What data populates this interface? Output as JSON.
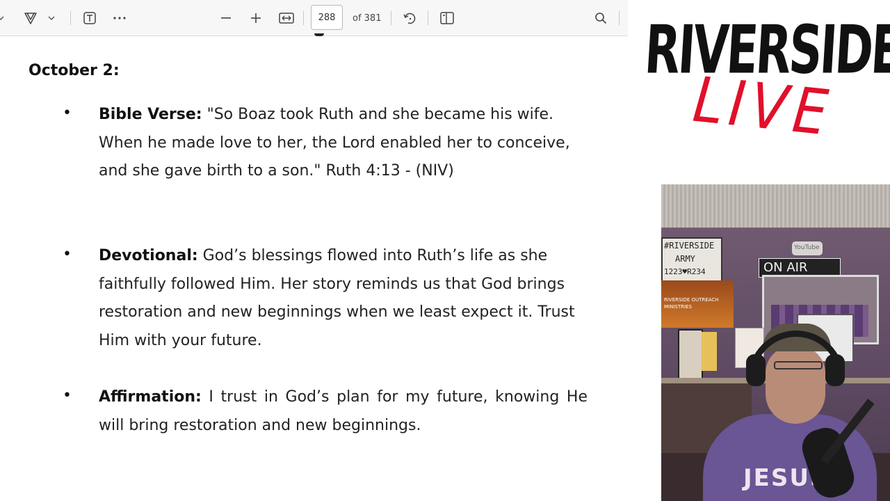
{
  "toolbar": {
    "page_number": "288",
    "page_total": "of 381"
  },
  "document": {
    "date": "October 2:",
    "items": [
      {
        "label": "Bible Verse:",
        "text": " \"So Boaz took Ruth and she became his wife. When he made love to her, the Lord enabled her to conceive, and she gave birth to a son.\" Ruth 4:13 - (NIV)"
      },
      {
        "label": "Devotional:",
        "text": " God’s blessings flowed into Ruth’s life as she faithfully followed Him. Her story reminds us that God brings restoration and new beginnings when we least expect it. Trust Him with your future."
      },
      {
        "label": "Affirmation:",
        "text": " I trust in God’s plan for my future, knowing He will bring restoration and new beginnings."
      }
    ]
  },
  "logo": {
    "line1": "RIVERSIDE",
    "line2": "LIVE"
  },
  "webcam": {
    "letterboard_line1": "#RIVERSIDE",
    "letterboard_line2": "ARMY",
    "letterboard_line3": "1223♥R234",
    "youtube_label": "YouTube",
    "on_air": "ON AIR",
    "banner_line1": "RIVERSIDE OUTREACH",
    "banner_line2": "MINISTRIES",
    "shirt_text": "JESUS"
  },
  "colors": {
    "logo_red": "#e0102a",
    "logo_black": "#111111",
    "toolbar_bg": "#f7f7f7"
  }
}
